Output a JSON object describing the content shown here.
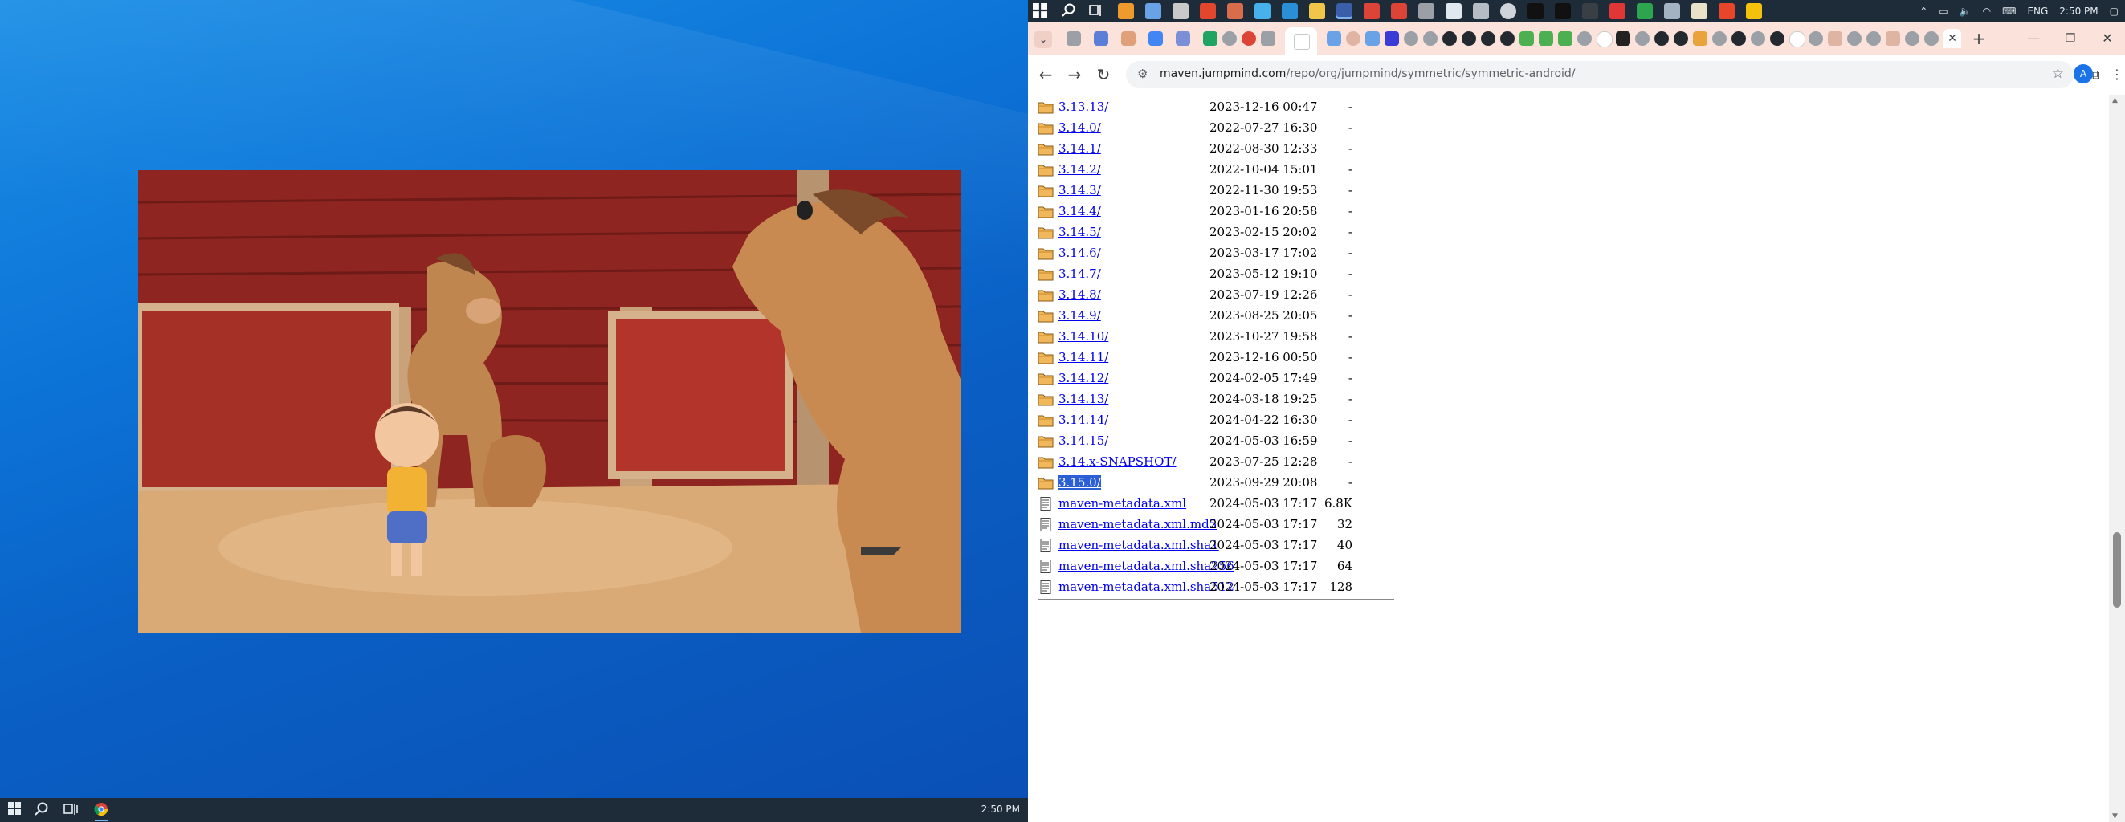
{
  "desktop": {
    "taskbar_time": "2:50 PM",
    "start_icon": "windows-start-icon",
    "search_icon": "search-icon",
    "taskview_icon": "task-view-icon",
    "chrome_icon": "chrome-icon"
  },
  "system_tray": {
    "language": "ENG",
    "time": "2:50 PM"
  },
  "browser": {
    "url_host": "maven.jumpmind.com",
    "url_path": "/repo/org/jumpmind/symmetric/symmetric-android/",
    "account_initial": "A"
  },
  "listing": {
    "entries": [
      {
        "name": "3.13.13/",
        "date": "2023-12-16 00:47",
        "size": "-",
        "type": "folder"
      },
      {
        "name": "3.14.0/",
        "date": "2022-07-27 16:30",
        "size": "-",
        "type": "folder"
      },
      {
        "name": "3.14.1/",
        "date": "2022-08-30 12:33",
        "size": "-",
        "type": "folder"
      },
      {
        "name": "3.14.2/",
        "date": "2022-10-04 15:01",
        "size": "-",
        "type": "folder"
      },
      {
        "name": "3.14.3/",
        "date": "2022-11-30 19:53",
        "size": "-",
        "type": "folder"
      },
      {
        "name": "3.14.4/",
        "date": "2023-01-16 20:58",
        "size": "-",
        "type": "folder"
      },
      {
        "name": "3.14.5/",
        "date": "2023-02-15 20:02",
        "size": "-",
        "type": "folder"
      },
      {
        "name": "3.14.6/",
        "date": "2023-03-17 17:02",
        "size": "-",
        "type": "folder"
      },
      {
        "name": "3.14.7/",
        "date": "2023-05-12 19:10",
        "size": "-",
        "type": "folder"
      },
      {
        "name": "3.14.8/",
        "date": "2023-07-19 12:26",
        "size": "-",
        "type": "folder"
      },
      {
        "name": "3.14.9/",
        "date": "2023-08-25 20:05",
        "size": "-",
        "type": "folder"
      },
      {
        "name": "3.14.10/",
        "date": "2023-10-27 19:58",
        "size": "-",
        "type": "folder"
      },
      {
        "name": "3.14.11/",
        "date": "2023-12-16 00:50",
        "size": "-",
        "type": "folder"
      },
      {
        "name": "3.14.12/",
        "date": "2024-02-05 17:49",
        "size": "-",
        "type": "folder"
      },
      {
        "name": "3.14.13/",
        "date": "2024-03-18 19:25",
        "size": "-",
        "type": "folder"
      },
      {
        "name": "3.14.14/",
        "date": "2024-04-22 16:30",
        "size": "-",
        "type": "folder"
      },
      {
        "name": "3.14.15/",
        "date": "2024-05-03 16:59",
        "size": "-",
        "type": "folder"
      },
      {
        "name": "3.14.x-SNAPSHOT/",
        "date": "2023-07-25 12:28",
        "size": "-",
        "type": "folder"
      },
      {
        "name": "3.15.0/",
        "date": "2023-09-29 20:08",
        "size": "-",
        "type": "folder",
        "selected": true
      },
      {
        "name": "maven-metadata.xml",
        "date": "2024-05-03 17:17",
        "size": "6.8K",
        "type": "file"
      },
      {
        "name": "maven-metadata.xml.md5",
        "date": "2024-05-03 17:17",
        "size": "32",
        "type": "file"
      },
      {
        "name": "maven-metadata.xml.sha1",
        "date": "2024-05-03 17:17",
        "size": "40",
        "type": "file"
      },
      {
        "name": "maven-metadata.xml.sha256",
        "date": "2024-05-03 17:17",
        "size": "64",
        "type": "file"
      },
      {
        "name": "maven-metadata.xml.sha512",
        "date": "2024-05-03 17:17",
        "size": "128",
        "type": "file"
      }
    ]
  },
  "colors": {
    "link": "#0000ee",
    "selection": "#2b5fd6",
    "tabstrip": "#fbe3dc",
    "taskbar": "#1e2b38"
  }
}
